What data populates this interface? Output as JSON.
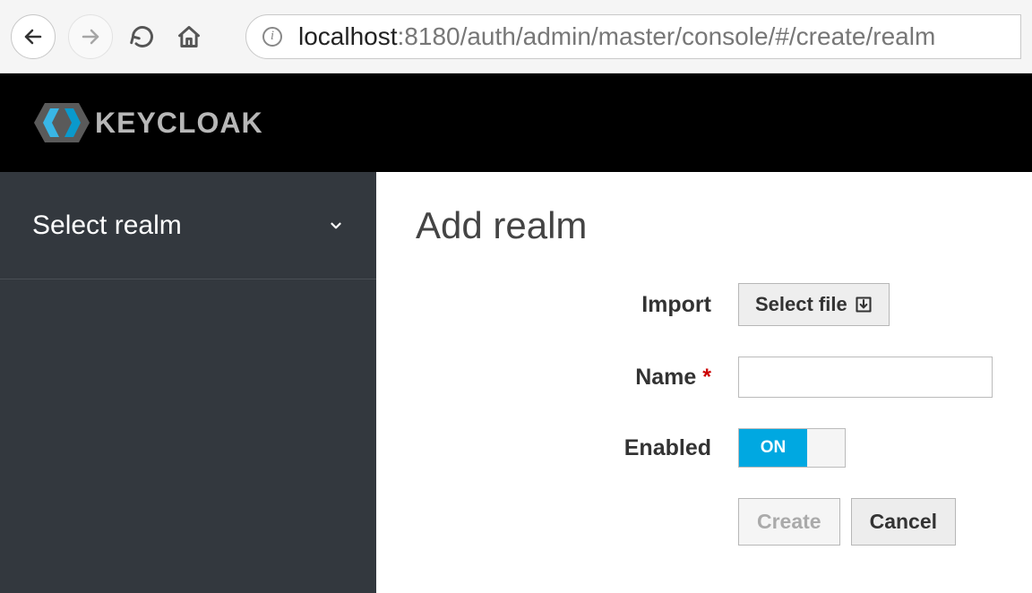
{
  "browser": {
    "url_host": "localhost",
    "url_path": ":8180/auth/admin/master/console/#/create/realm"
  },
  "header": {
    "logo_text": "KEYCLOAK"
  },
  "sidebar": {
    "realm_selector_label": "Select realm"
  },
  "page": {
    "title": "Add realm",
    "form": {
      "import_label": "Import",
      "select_file_label": "Select file",
      "name_label": "Name",
      "name_required": "*",
      "name_value": "",
      "enabled_label": "Enabled",
      "enabled_on": "ON",
      "create_label": "Create",
      "cancel_label": "Cancel"
    }
  }
}
